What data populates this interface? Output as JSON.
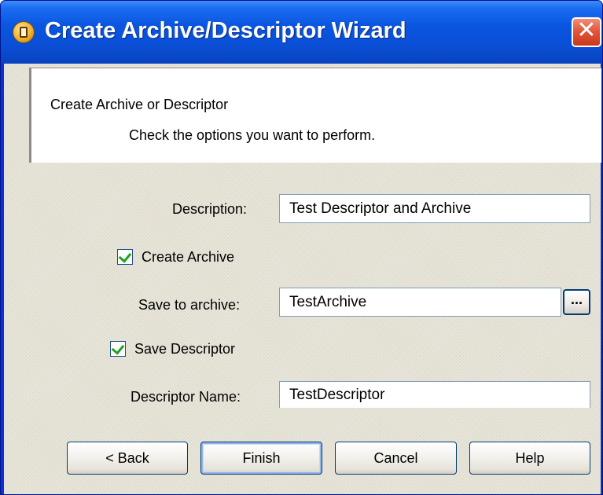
{
  "window": {
    "title": "Create Archive/Descriptor Wizard",
    "close_glyph": "✕",
    "icon": "wizard-app-icon"
  },
  "header": {
    "title": "Create Archive or Descriptor",
    "subtitle": "Check the options you want to perform."
  },
  "form": {
    "description_label": "Description:",
    "description_value": "Test Descriptor and Archive",
    "create_archive_label": "Create Archive",
    "create_archive_checked": true,
    "save_to_archive_label": "Save to archive:",
    "save_to_archive_value": "TestArchive",
    "browse_label": "...",
    "save_descriptor_label": "Save Descriptor",
    "save_descriptor_checked": true,
    "descriptor_name_label": "Descriptor Name:",
    "descriptor_name_value": "TestDescriptor"
  },
  "buttons": {
    "back": "< Back",
    "finish": "Finish",
    "cancel": "Cancel",
    "help": "Help"
  },
  "colors": {
    "titlebar": "#0a55e0",
    "close_button": "#e2563a",
    "dialog_bg": "#e5e2d6",
    "checkmark": "#21a121"
  }
}
